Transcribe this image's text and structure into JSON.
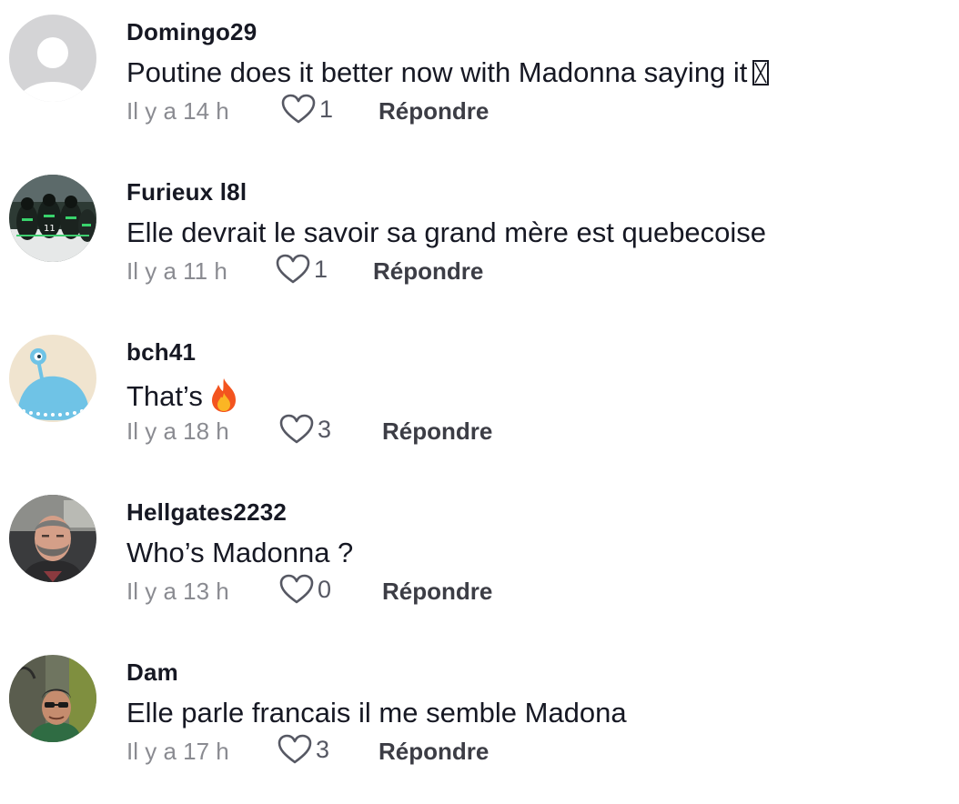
{
  "comments": [
    {
      "username": "Domingo29",
      "text": "Poutine does it better now with Madonna saying it",
      "trailing_glyph": "missing-emoji-box",
      "time": "Il y a 14 h",
      "likes": "1",
      "reply_label": "Répondre",
      "avatar": "default-avatar"
    },
    {
      "username": "Furieux l8l",
      "text": "Elle devrait le savoir sa grand mère est quebecoise",
      "time": "Il y a 11 h",
      "likes": "1",
      "reply_label": "Répondre",
      "avatar": "hockey-team-photo"
    },
    {
      "username": "bch41",
      "text": "That’s",
      "trailing_glyph": "fire-emoji",
      "time": "Il y a 18 h",
      "likes": "3",
      "reply_label": "Répondre",
      "avatar": "blue-alien-ufo"
    },
    {
      "username": "Hellgates2232",
      "text": "Who’s Madonna ?",
      "time": "Il y a 13 h",
      "likes": "0",
      "reply_label": "Répondre",
      "avatar": "man-in-car-selfie"
    },
    {
      "username": "Dam",
      "text": "Elle parle francais il me semble Madona",
      "time": "Il y a 17 h",
      "likes": "3",
      "reply_label": "Répondre",
      "avatar": "man-with-sunglasses-outdoor"
    }
  ],
  "colors": {
    "username": "#161823",
    "text": "#161823",
    "time": "#8a8b91",
    "like_icon": "#565863",
    "reply": "#3c3d45",
    "default_avatar_bg": "#d5d5d7"
  }
}
